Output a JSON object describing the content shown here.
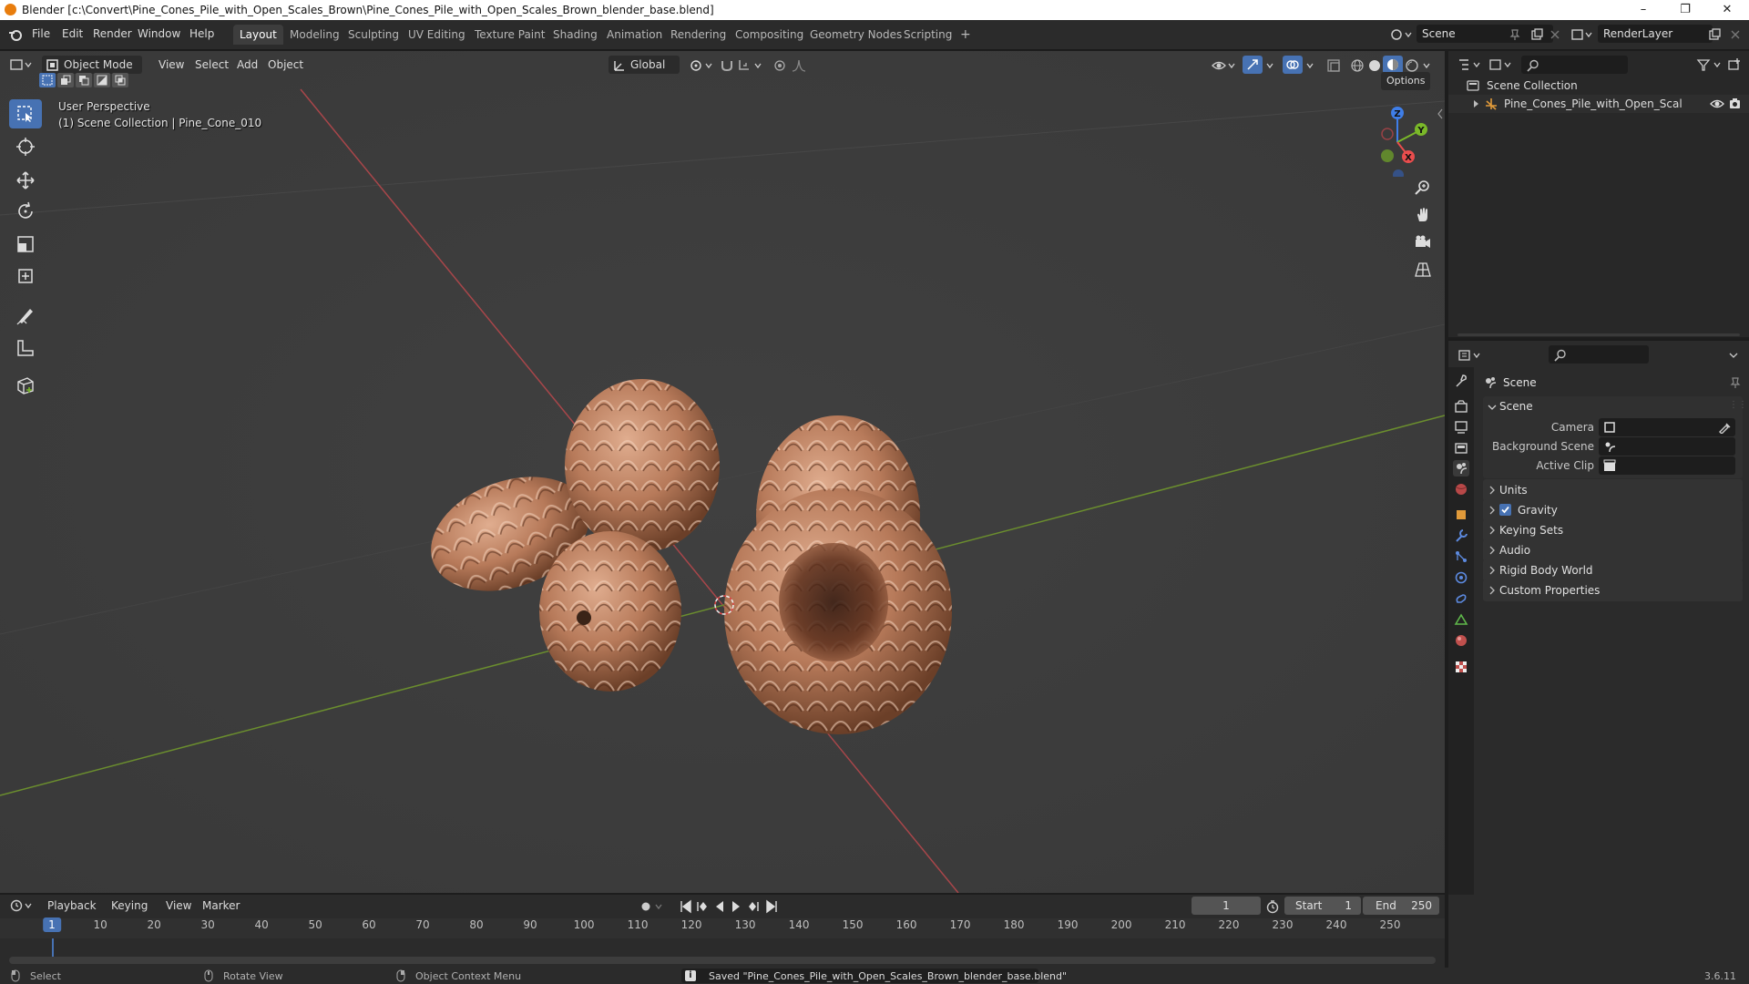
{
  "window": {
    "title": "Blender [c:\\Convert\\Pine_Cones_Pile_with_Open_Scales_Brown\\Pine_Cones_Pile_with_Open_Scales_Brown_blender_base.blend]",
    "minimize": "–",
    "maximize": "❐",
    "close": "✕"
  },
  "menu": {
    "file": "File",
    "edit": "Edit",
    "render": "Render",
    "window": "Window",
    "help": "Help"
  },
  "workspaces": [
    "Layout",
    "Modeling",
    "Sculpting",
    "UV Editing",
    "Texture Paint",
    "Shading",
    "Animation",
    "Rendering",
    "Compositing",
    "Geometry Nodes",
    "Scripting"
  ],
  "workspace_add": "+",
  "scene_field": "Scene",
  "renderlayer_field": "RenderLayer",
  "viewport": {
    "mode": "Object Mode",
    "view": "View",
    "select": "Select",
    "add": "Add",
    "object": "Object",
    "orientation": "Global",
    "options": "Options",
    "perspective": "User Perspective",
    "collection_info": "(1) Scene Collection | Pine_Cone_010",
    "gizmo_x": "X",
    "gizmo_y": "Y",
    "gizmo_z": "Z"
  },
  "outliner": {
    "root": "Scene Collection",
    "item": "Pine_Cones_Pile_with_Open_Scales_Bro"
  },
  "properties": {
    "header": "Scene",
    "section": "Scene",
    "camera_label": "Camera",
    "background_label": "Background Scene",
    "clip_label": "Active Clip",
    "panels": [
      "Units",
      "Gravity",
      "Keying Sets",
      "Audio",
      "Rigid Body World",
      "Custom Properties"
    ],
    "gravity_checked": true
  },
  "timeline": {
    "playback": "Playback",
    "keying": "Keying",
    "view": "View",
    "marker": "Marker",
    "current_frame": "1",
    "start_label": "Start",
    "start_value": "1",
    "end_label": "End",
    "end_value": "250",
    "ruler": [
      "1",
      "10",
      "20",
      "30",
      "40",
      "50",
      "60",
      "70",
      "80",
      "90",
      "100",
      "110",
      "120",
      "130",
      "140",
      "150",
      "160",
      "170",
      "180",
      "190",
      "200",
      "210",
      "220",
      "230",
      "240",
      "250"
    ]
  },
  "status": {
    "select": "Select",
    "rotate": "Rotate View",
    "context": "Object Context Menu",
    "message": "Saved \"Pine_Cones_Pile_with_Open_Scales_Brown_blender_base.blend\"",
    "version": "3.6.11"
  },
  "colors": {
    "accent": "#4772b3",
    "x_axis": "#e94d4d",
    "y_axis": "#7ab829",
    "z_axis": "#3f7ee8",
    "cone": "#b77a5a"
  }
}
